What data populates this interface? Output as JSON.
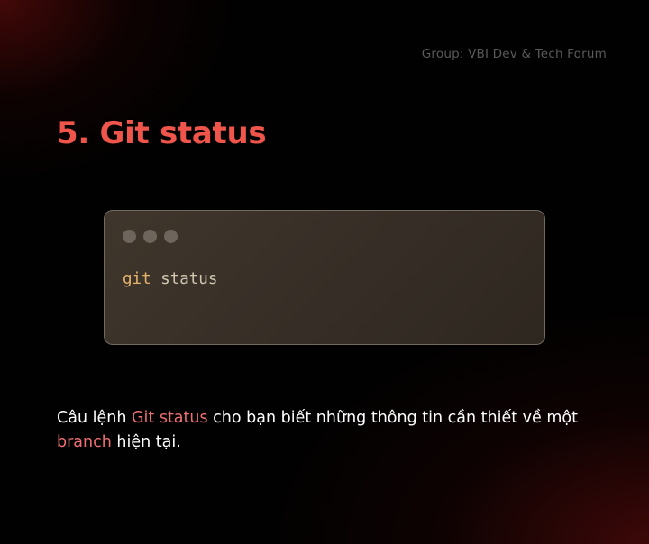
{
  "header": {
    "group_label": "Group: VBI Dev & Tech Forum"
  },
  "title": "5. Git status",
  "code_window": {
    "dots": [
      "window-dot",
      "window-dot",
      "window-dot"
    ],
    "command": "git",
    "argument": "status"
  },
  "description": {
    "part1": "Câu lệnh ",
    "highlight1": "Git status",
    "part2": " cho bạn biết những thông tin cần thiết về một ",
    "highlight2": "branch",
    "part3": " hiện tại."
  },
  "colors": {
    "title": "#f0554b",
    "highlight": "#ef6f72",
    "code_command": "#e8b46d",
    "code_argument": "#d2c6b0",
    "window_background": "#3a3129",
    "window_border": "#736a5e",
    "background": "#020101",
    "accent_glow": "#6e0e0e"
  }
}
